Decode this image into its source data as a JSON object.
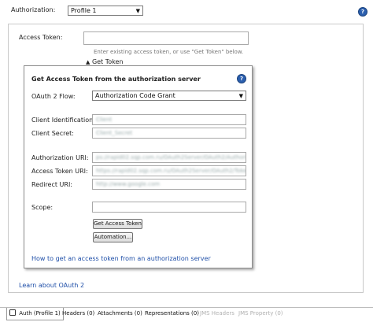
{
  "authorization": {
    "label": "Authorization:",
    "profile_value": "Profile 1"
  },
  "access_token": {
    "label": "Access Token:",
    "value": "",
    "hint": "Enter existing access token, or use \"Get Token\" below.",
    "get_token_toggle": "Get Token"
  },
  "dialog": {
    "title": "Get Access Token from the authorization server",
    "flow_label": "OAuth 2 Flow:",
    "flow_value": "Authorization Code Grant",
    "client_id_label": "Client Identification:",
    "client_id_value": "Client",
    "client_secret_label": "Client Secret:",
    "client_secret_value": "Client_Secret",
    "auth_uri_label": "Authorization URI:",
    "auth_uri_value": "ps://rapid02.sqp.com.ru/OAuth2Server/OAuth2/Authorize",
    "token_uri_label": "Access Token URI:",
    "token_uri_value": "https://rapid02.sqp.com.ru/OAuth2Server/OAuth2/Token",
    "redirect_uri_label": "Redirect URI:",
    "redirect_uri_value": "http://www.google.com",
    "scope_label": "Scope:",
    "scope_value": "",
    "get_token_button": "Get Access Token",
    "automation_button": "Automation...",
    "howto_link": "How to get an access token from an authorization server"
  },
  "learn_link": "Learn about OAuth 2",
  "tabs": [
    {
      "label": "Auth (Profile 1)",
      "active": true,
      "enabled": true
    },
    {
      "label": "Headers (0)",
      "enabled": true
    },
    {
      "label": "Attachments (0)",
      "enabled": true
    },
    {
      "label": "Representations (0)",
      "enabled": true
    },
    {
      "label": "JMS Headers",
      "enabled": false
    },
    {
      "label": "JMS Property (0)",
      "enabled": false
    }
  ],
  "colors": {
    "link": "#1f4fa8",
    "help_icon": "#2b5fae",
    "disabled_tab": "#b0b0b0"
  },
  "icons": {
    "help": "help-icon",
    "lock": "lock-icon",
    "dropdown": "chevron-down-icon",
    "expand": "triangle-up-icon"
  }
}
